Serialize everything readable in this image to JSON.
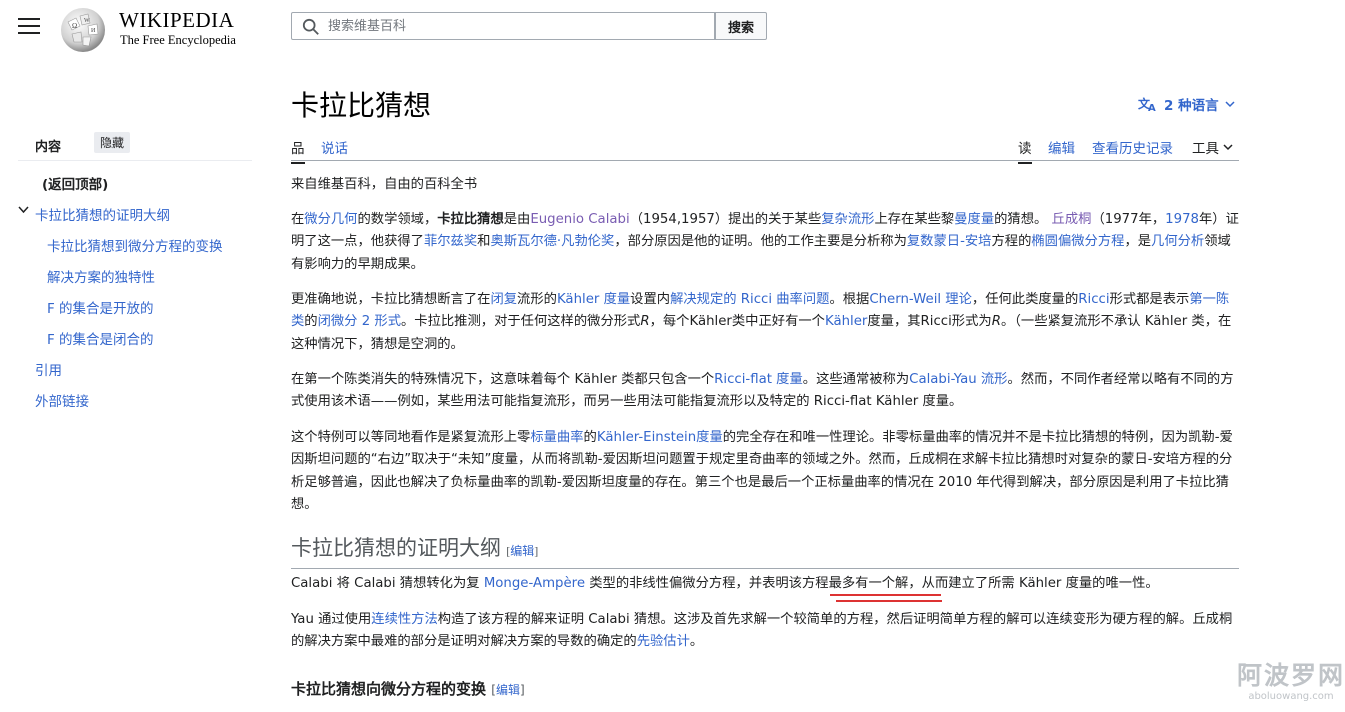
{
  "header": {
    "wordmark_main": "WIKIPEDIA",
    "tagline": "The Free Encyclopedia",
    "search_placeholder": "搜索维基百科",
    "search_button": "搜索"
  },
  "toc": {
    "title": "内容",
    "hide": "隐藏",
    "items": [
      {
        "label": "(返回顶部)"
      },
      {
        "label": "卡拉比猜想的证明大纲"
      },
      {
        "label": "卡拉比猜想到微分方程的变换"
      },
      {
        "label": "解决方案的独特性"
      },
      {
        "label": "F 的集合是开放的"
      },
      {
        "label": "F 的集合是闭合的"
      },
      {
        "label": "引用"
      },
      {
        "label": "外部链接"
      }
    ]
  },
  "article": {
    "title": "卡拉比猜想",
    "languages": "2 种语言",
    "tabs_left": [
      "品",
      "说话"
    ],
    "tabs_right": [
      "读",
      "编辑",
      "查看历史记录",
      "工具"
    ],
    "from": "来自维基百科，自由的百科全书",
    "p1": {
      "a": "在",
      "b": "微分几何",
      "c": "的数学领域，",
      "d": "卡拉比猜想",
      "e": "是由",
      "f": "Eugenio Calabi",
      "g": "（1954,1957）提出的关于某些",
      "h": "复杂流形",
      "i": "上存在某些黎",
      "j": "曼度量",
      "k": "的猜想。",
      "l": "丘成桐",
      "m": "（1977年，",
      "n": "1978",
      "o": "年）证明了这一点，他获得了",
      "p": "菲尔兹奖",
      "q": "和",
      "r": "奥斯瓦尔德·凡勃伦奖",
      "s": "，部分原因是他的证明。他的工作主要是分析称为",
      "t": "复数蒙日-安培",
      "u": "方程的",
      "v": "椭圆偏微分方程",
      "w": "，是",
      "x": "几何分析",
      "y": "领域有影响力的早期成果。"
    },
    "p2": {
      "a": "更准确地说，卡拉比猜想断言了在",
      "b": "闭复",
      "c": "流形的",
      "d": "Kähler 度量",
      "e": "设置内",
      "f": "解决规定的 Ricci 曲率问题",
      "g": "。根据",
      "h": "Chern-Weil 理论",
      "i": "，任何此类度量的",
      "j": "Ricci",
      "k": "形式都是表示",
      "l": "第一陈类",
      "m": "的",
      "n": "闭微分 2 形式",
      "o": "。卡拉比推测，对于任何这样的微分形式",
      "p": "R",
      "q": "，每个Kähler类中正好有一个",
      "r": "Kähler",
      "s": "度量，其Ricci形式为",
      "t": "R",
      "u": "。（一些紧复流形不承认 Kähler 类，在这种情况下，猜想是空洞的。"
    },
    "p3": {
      "a": "在第一个陈类消失的特殊情况下，这意味着每个 Kähler 类都只包含一个",
      "b": "Ricci-flat 度量",
      "c": "。这些通常被称为",
      "d": "Calabi-Yau 流形",
      "e": "。然而，不同作者经常以略有不同的方式使用该术语——例如，某些用法可能指复流形，而另一些用法可能指复流形以及特定的 Ricci-flat Kähler 度量。"
    },
    "p4": {
      "a": "这个特例可以等同地看作是紧复流形上零",
      "b": "标量曲率",
      "c": "的",
      "d": "Kähler-Einstein度量",
      "e": "的完全存在和唯一性理论。非零标量曲率的情况并不是卡拉比猜想的特例，因为凯勒-爱因斯坦问题的“右边”取决于“未知”度量，从而将凯勒-爱因斯坦问题置于规定里奇曲率的领域之外。然而，丘成桐在求解卡拉比猜想时对复杂的蒙日-安培方程的分析足够普遍，因此也解决了负标量曲率的凯勒-爱因斯坦度量的存在。第三个也是最后一个正标量曲率的情况在 2010 年代得到解决，部分原因是利用了卡拉比猜想。"
    },
    "h2": "卡拉比猜想的证明大纲",
    "edit_label": "编辑",
    "p5": {
      "a": "Calabi 将 Calabi 猜想转化为复 ",
      "b": "Monge-Ampère",
      "c": " 类型的非线性偏微分方程，并表明该方程",
      "d": "最多有一个解",
      "e": "，从而建立了所需 Kähler 度量的唯一性。"
    },
    "p6": {
      "a": "Yau 通过使用",
      "b": "连续性方法",
      "c": "构造了该方程的解来证明 Calabi 猜想。这涉及首先求解一个较简单的方程，然后证明简单方程的解可以连续变形为硬方程的解。丘成桐的解决方案中最难的部分是证明对解决方案的导数的确定的",
      "d": "先验估计",
      "e": "。"
    },
    "h3": "卡拉比猜想向微分方程的变换"
  },
  "watermark": {
    "big": "阿波罗网",
    "small": "aboluowang.com"
  },
  "colors": {
    "link": "#3366cc",
    "visited": "#795cb2",
    "underline_red": "#dd3333"
  }
}
